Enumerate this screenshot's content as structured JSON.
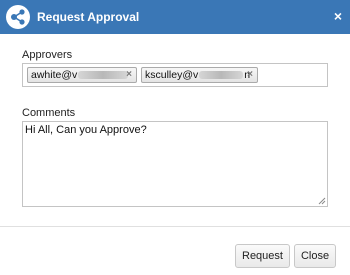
{
  "dialog": {
    "title": "Request Approval",
    "close_glyph": "×"
  },
  "approvers": {
    "label": "Approvers",
    "chips": [
      {
        "prefix": "awhite@v",
        "suffix": "",
        "remove": "×"
      },
      {
        "prefix": "ksculley@v",
        "suffix": "n",
        "remove": "×"
      }
    ]
  },
  "comments": {
    "label": "Comments",
    "value": "Hi All, Can you Approve?"
  },
  "buttons": {
    "request": "Request",
    "close": "Close"
  },
  "colors": {
    "titlebar": "#3a77b6",
    "chip_border": "#aaaaaa"
  },
  "icons": {
    "title": "share-nodes-icon"
  }
}
